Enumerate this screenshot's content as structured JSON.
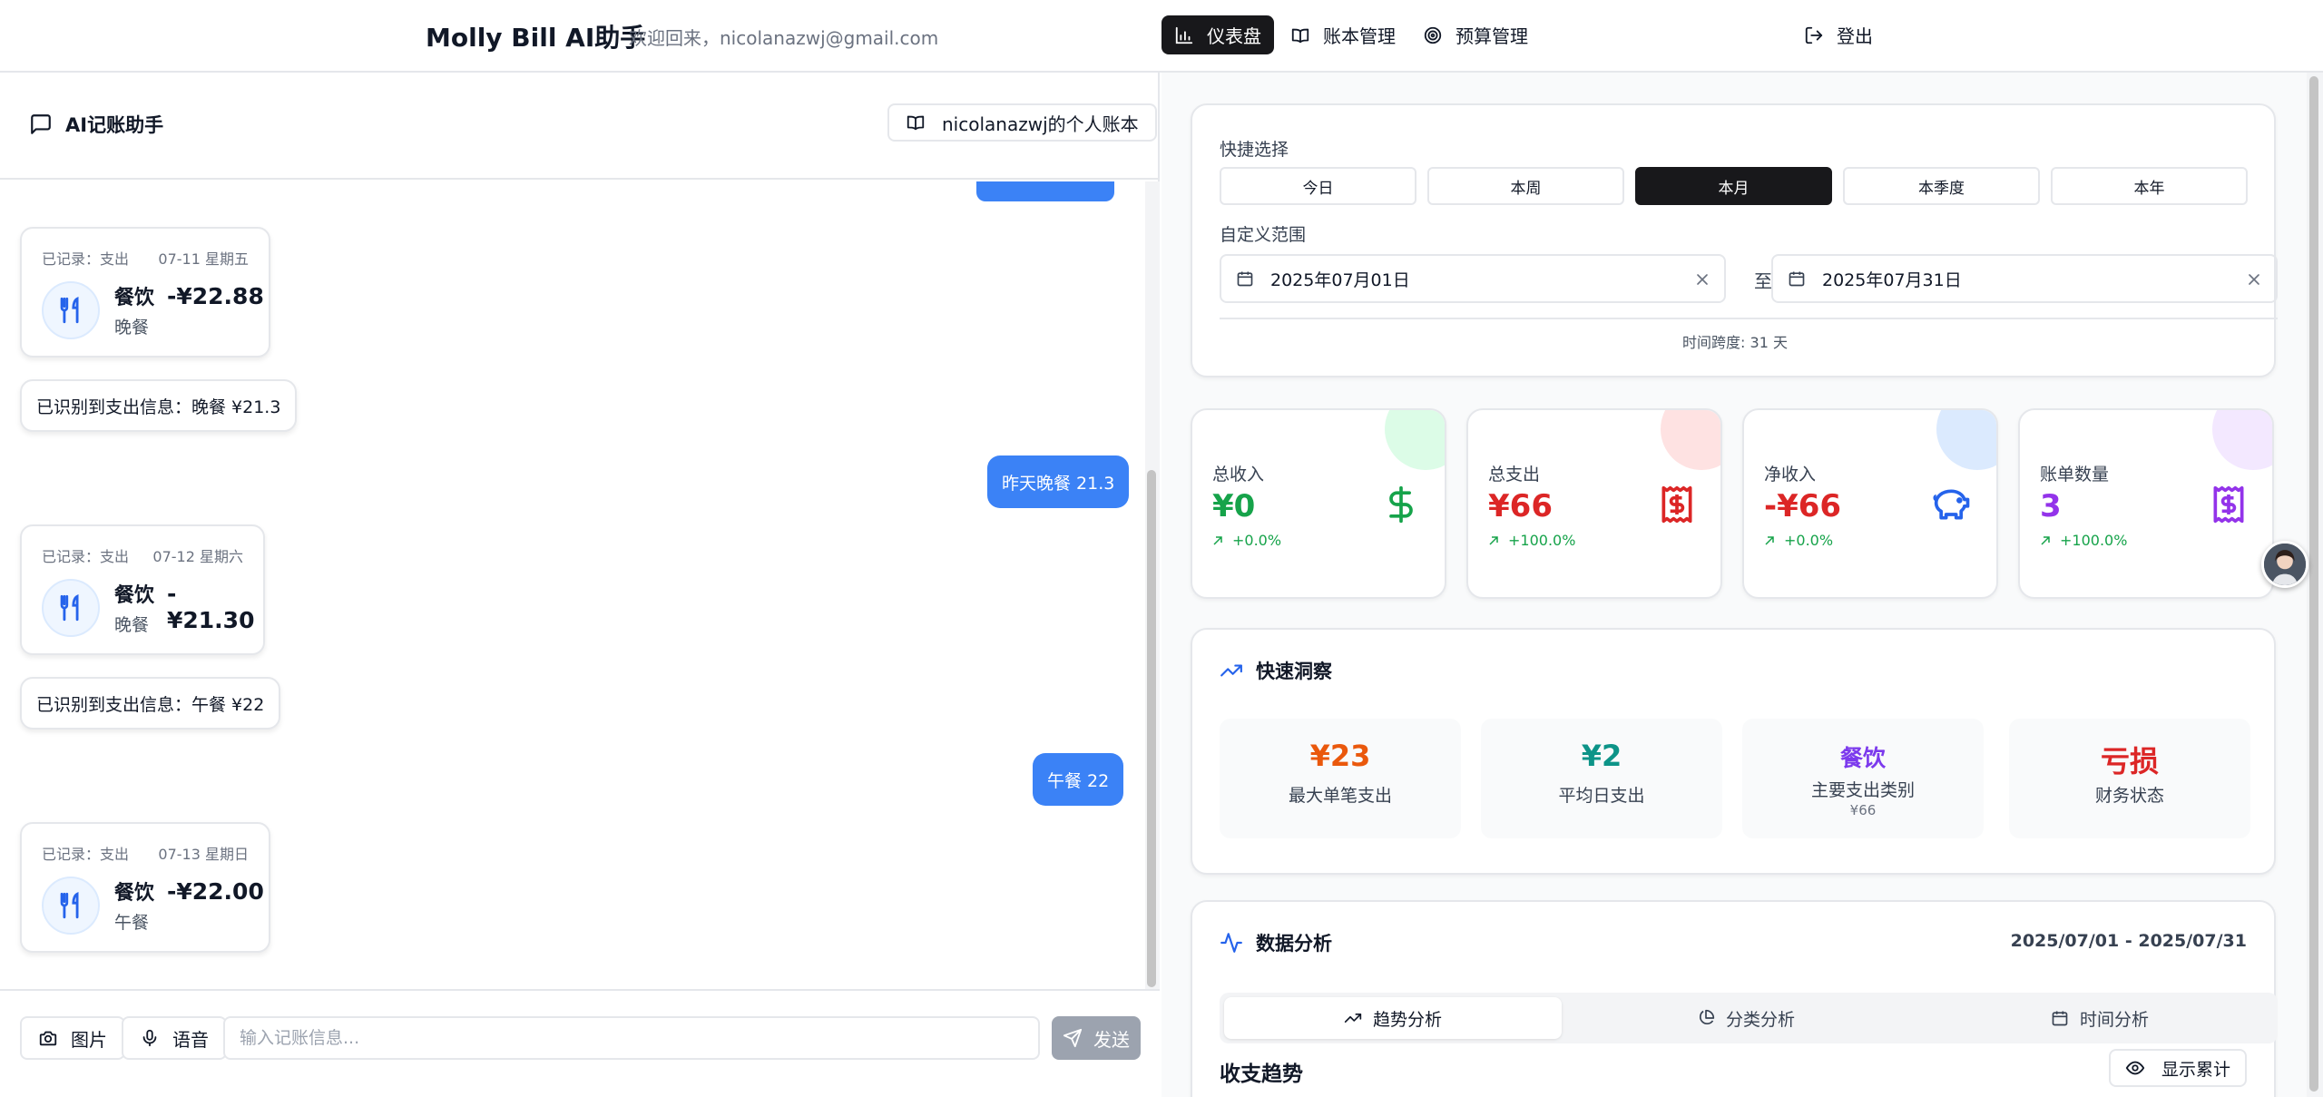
{
  "nav": {
    "brand": "Molly Bill AI助手",
    "welcome": "欢迎回来，nicolanazwj@gmail.com",
    "items": [
      {
        "label": "仪表盘",
        "icon": "bar-chart-icon",
        "active": true
      },
      {
        "label": "账本管理",
        "icon": "book-icon",
        "active": false
      },
      {
        "label": "预算管理",
        "icon": "target-icon",
        "active": false
      }
    ],
    "logout": "登出"
  },
  "assistant": {
    "title": "AI记账助手",
    "ledger": "nicolanazwj的个人账本",
    "messages": [
      {
        "type": "record",
        "status": "已记录：支出",
        "date": "07-11 星期五",
        "category": "餐饮",
        "amount": "-¥22.88",
        "note": "晚餐"
      },
      {
        "type": "system",
        "text": "已识别到支出信息：晚餐 ¥21.3"
      },
      {
        "type": "user",
        "text": "昨天晚餐 21.3"
      },
      {
        "type": "record",
        "status": "已记录：支出",
        "date": "07-12 星期六",
        "category": "餐饮",
        "amount": "-¥21.30",
        "note": "晚餐"
      },
      {
        "type": "system",
        "text": "已识别到支出信息：午餐 ¥22"
      },
      {
        "type": "user",
        "text": "午餐 22"
      },
      {
        "type": "record",
        "status": "已记录：支出",
        "date": "07-13 星期日",
        "category": "餐饮",
        "amount": "-¥22.00",
        "note": "午餐"
      }
    ],
    "image_btn": "图片",
    "voice_btn": "语音",
    "input_placeholder": "输入记账信息...",
    "send_btn": "发送"
  },
  "dashboard": {
    "quick_label": "快捷选择",
    "quick_options": [
      "今日",
      "本周",
      "本月",
      "本季度",
      "本年"
    ],
    "quick_selected": "本月",
    "custom_label": "自定义范围",
    "start_date": "2025年07月01日",
    "end_date": "2025年07月31日",
    "to": "至",
    "span": "时间跨度: 31 天",
    "stats": [
      {
        "label": "总收入",
        "value": "¥0",
        "change": "+0.0%",
        "color": "#16a34a",
        "blob": "#dcfce7",
        "icon": "dollar-icon"
      },
      {
        "label": "总支出",
        "value": "¥66",
        "change": "+100.0%",
        "color": "#dc2626",
        "blob": "#fee2e2",
        "icon": "receipt-icon"
      },
      {
        "label": "净收入",
        "value": "-¥66",
        "change": "+0.0%",
        "color": "#dc2626",
        "blob": "#dbeafe",
        "icon": "piggy-bank-icon"
      },
      {
        "label": "账单数量",
        "value": "3",
        "change": "+100.0%",
        "color": "#9333ea",
        "blob": "#f3e8ff",
        "icon": "receipt-icon"
      }
    ],
    "insights_title": "快速洞察",
    "insights": [
      {
        "value": "¥23",
        "label": "最大单笔支出",
        "color": "#ea580c"
      },
      {
        "value": "¥2",
        "label": "平均日支出",
        "color": "#0d9488"
      },
      {
        "value": "餐饮",
        "label": "主要支出类别",
        "sub": "¥66",
        "color": "#7c3aed"
      },
      {
        "value": "亏损",
        "label": "财务状态",
        "color": "#dc2626"
      }
    ],
    "analysis_title": "数据分析",
    "analysis_range": "2025/07/01 - 2025/07/31",
    "tabs": [
      {
        "label": "趋势分析",
        "icon": "trending-up-icon",
        "active": true
      },
      {
        "label": "分类分析",
        "icon": "pie-chart-icon",
        "active": false
      },
      {
        "label": "时间分析",
        "icon": "calendar-icon",
        "active": false
      }
    ],
    "trend_title": "收支趋势",
    "cumulative_btn": "显示累计"
  }
}
